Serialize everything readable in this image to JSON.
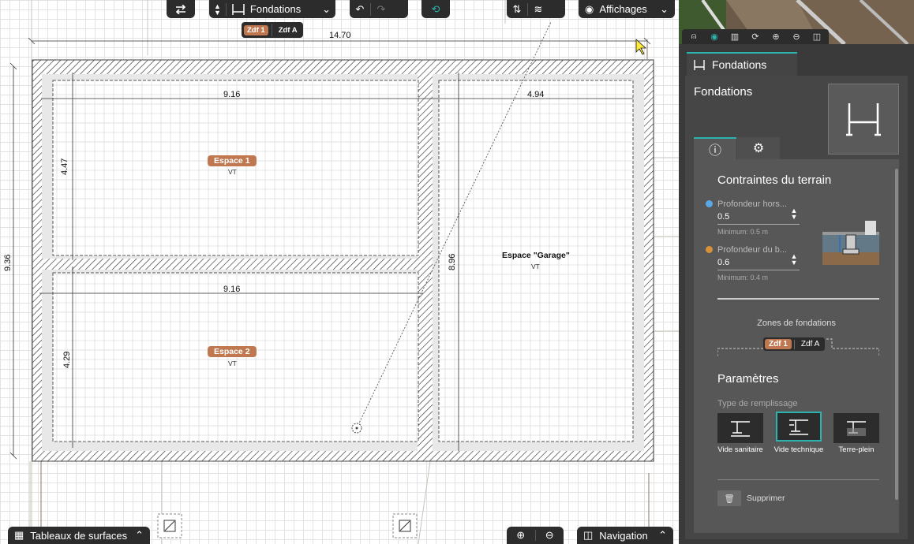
{
  "toolbar": {
    "tool_label": "Fondations",
    "display_label": "Affichages",
    "zones": [
      "Zdf 1",
      "Zdf A"
    ]
  },
  "plan": {
    "dimensions": {
      "total_width": "14.70",
      "room1_width": "9.16",
      "room2_width": "9.16",
      "garage_width": "4.94",
      "room1_height": "4.47",
      "room2_height": "4.29",
      "garage_height": "8.96",
      "total_height": "9.36"
    },
    "rooms": [
      {
        "name": "Espace 1",
        "sub": "VT"
      },
      {
        "name": "Espace 2",
        "sub": "VT"
      },
      {
        "name": "Espace \"Garage\"",
        "sub": "VT"
      }
    ]
  },
  "bottom": {
    "surfaces_label": "Tableaux de surfaces",
    "navigation_label": "Navigation"
  },
  "panel": {
    "tab_label": "Fondations",
    "title": "Fondations",
    "constraints_title": "Contraintes du terrain",
    "field1": {
      "label": "Profondeur hors...",
      "value": "0.5",
      "hint": "Minimum: 0.5 m",
      "color": "#5aa9e6"
    },
    "field2": {
      "label": "Profondeur du b...",
      "value": "0.6",
      "hint": "Minimum: 0.4 m",
      "color": "#d9903a"
    },
    "zones_title": "Zones de fondations",
    "zones": [
      "Zdf 1",
      "Zdf A"
    ],
    "params_title": "Paramètres",
    "fill_type_label": "Type de remplissage",
    "fill_options": [
      "Vide sanitaire",
      "Vide technique",
      "Terre-plein"
    ],
    "delete_label": "Supprimer",
    "colors": {
      "accent": "#2bb3b0",
      "zone_active": "#c07850"
    }
  }
}
